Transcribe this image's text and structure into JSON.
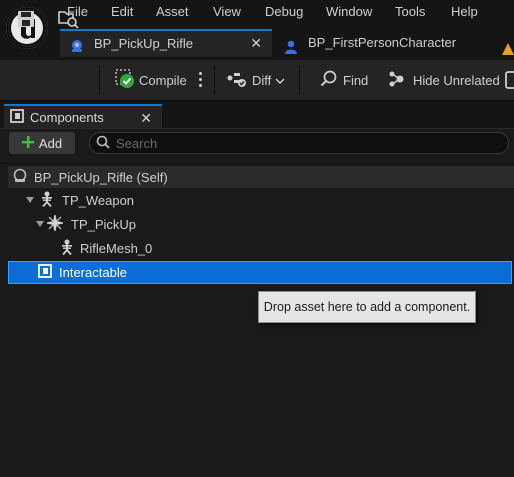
{
  "menu": [
    "File",
    "Edit",
    "Asset",
    "View",
    "Debug",
    "Window",
    "Tools",
    "Help"
  ],
  "tabs": [
    {
      "label": "BP_PickUp_Rifle",
      "active": true
    },
    {
      "label": "BP_FirstPersonCharacter",
      "active": false
    }
  ],
  "toolbar": {
    "compile_label": "Compile",
    "diff_label": "Diff",
    "find_label": "Find",
    "hide_unrelated_label": "Hide Unrelated"
  },
  "components_panel": {
    "title": "Components",
    "add_label": "Add",
    "search_placeholder": "Search",
    "tree": [
      {
        "label": "BP_PickUp_Rifle (Self)",
        "icon": "actor-icon",
        "selected": false
      },
      {
        "label": "TP_Weapon",
        "icon": "skeletal-mesh-icon",
        "expanded": true
      },
      {
        "label": "TP_PickUp",
        "icon": "scene-component-icon",
        "expanded": true
      },
      {
        "label": "RifleMesh_0",
        "icon": "skeletal-mesh-icon"
      },
      {
        "label": "Interactable",
        "icon": "actor-component-icon",
        "selected": true
      }
    ],
    "drop_hint": "Drop asset here to add a component."
  },
  "colors": {
    "accent": "#0a7bd6",
    "selection": "#0a6ed6",
    "background": "#151515",
    "panel": "#242424"
  }
}
